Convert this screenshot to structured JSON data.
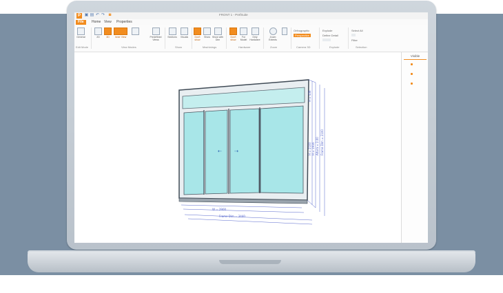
{
  "window": {
    "title": "FRONT 1 - PrefSuite"
  },
  "quick_access": [
    "save-icon",
    "print-icon",
    "undo-icon",
    "redo-icon",
    "zoom-icon"
  ],
  "menu_tabs": [
    "File",
    "Home",
    "View",
    "Properties"
  ],
  "ribbon": {
    "groups": [
      "Edit Mode",
      "View Modes",
      "Show",
      "Machinings",
      "Hardware",
      "Zoom",
      "Camera 3D",
      "Explode",
      "Selection"
    ],
    "buttons": {
      "general": "General",
      "two_d": "2D",
      "three_d": "3D",
      "inner_view": "Inner View",
      "predefined_views": "Predefined Views",
      "sections": "Sections",
      "visuals": "Visuals",
      "dont_show_machinings": "Don't show",
      "show": "Show",
      "show_with_dim": "Show with Dim",
      "dont_show_hardware": "Don't show",
      "for_model": "For Model",
      "only_hardware": "Only Hardware",
      "zoom_extents": "Zoom Extents",
      "orthographic": "Orthographic",
      "perspective": "Perspective",
      "explode": "Explode",
      "define_detail": "Define Detail",
      "select_all": "Select All",
      "filter": "Filter"
    }
  },
  "visible_panel": {
    "title": "Visible",
    "items": 3
  },
  "drawing": {
    "dims": {
      "right_1": "H = 2100",
      "right_2": "H = 1916",
      "right_3": "Altura = 2.00",
      "right_4": "Frame Dim = 2100",
      "top_small": "H = 436",
      "bottom_1": "W = 2900",
      "bottom_2": "Frame Dim = 3440"
    }
  },
  "colors": {
    "accent": "#f28c1e",
    "glass": "#a8e6e8",
    "transom": "#c4eeee",
    "frame": "#3f4a55",
    "dim": "#5566cc",
    "bezel": "#c8cfd6"
  }
}
